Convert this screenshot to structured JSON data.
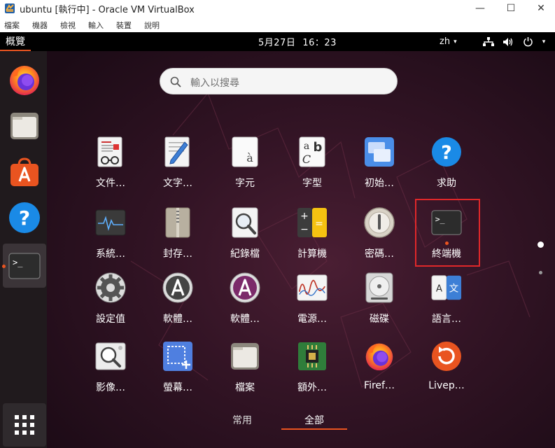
{
  "window": {
    "title": "ubuntu [執行中] - Oracle VM VirtualBox",
    "controls": {
      "minimize": "—",
      "maximize": "☐",
      "close": "✕"
    },
    "menu": [
      "檔案",
      "機器",
      "檢視",
      "輸入",
      "裝置",
      "說明"
    ]
  },
  "topbar": {
    "activities": "概覽",
    "date": "5月27日",
    "time": "16：23",
    "language": "zh",
    "caret": "▾"
  },
  "search": {
    "placeholder": "輸入以搜尋"
  },
  "apps": [
    {
      "label": "文件…",
      "icon": "document-viewer-icon"
    },
    {
      "label": "文字…",
      "icon": "text-editor-icon"
    },
    {
      "label": "字元",
      "icon": "characters-icon"
    },
    {
      "label": "字型",
      "icon": "fonts-icon"
    },
    {
      "label": "初始…",
      "icon": "initial-setup-icon"
    },
    {
      "label": "求助",
      "icon": "help-icon"
    },
    {
      "label": "系統…",
      "icon": "system-monitor-icon"
    },
    {
      "label": "封存…",
      "icon": "archive-manager-icon"
    },
    {
      "label": "紀錄檔",
      "icon": "logs-icon"
    },
    {
      "label": "計算機",
      "icon": "calculator-icon"
    },
    {
      "label": "密碼…",
      "icon": "passwords-icon"
    },
    {
      "label": "終端機",
      "icon": "terminal-icon"
    },
    {
      "label": "設定值",
      "icon": "settings-icon"
    },
    {
      "label": "軟體…",
      "icon": "software-updater-icon"
    },
    {
      "label": "軟體…",
      "icon": "software-properties-icon"
    },
    {
      "label": "電源…",
      "icon": "power-statistics-icon"
    },
    {
      "label": "磁碟",
      "icon": "disks-icon"
    },
    {
      "label": "語言…",
      "icon": "language-support-icon"
    },
    {
      "label": "影像…",
      "icon": "image-viewer-icon"
    },
    {
      "label": "螢幕…",
      "icon": "screenshot-icon"
    },
    {
      "label": "檔案",
      "icon": "files-icon"
    },
    {
      "label": "額外…",
      "icon": "additional-drivers-icon"
    },
    {
      "label": "Firef…",
      "icon": "firefox-icon"
    },
    {
      "label": "Livep…",
      "icon": "livepatch-icon"
    }
  ],
  "tabs": {
    "frequent": "常用",
    "all": "全部"
  },
  "colors": {
    "accent": "#e95420",
    "highlight": "#e0282a"
  }
}
